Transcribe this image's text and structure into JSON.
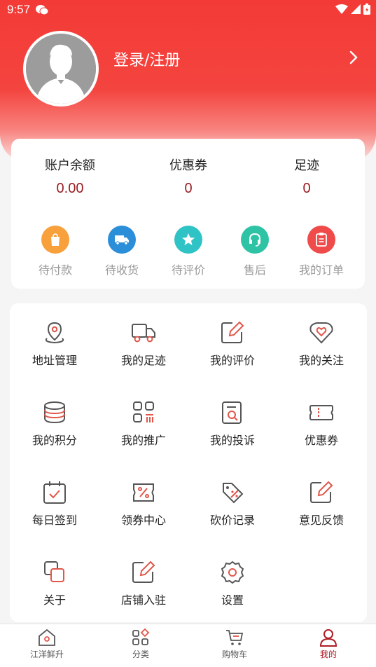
{
  "status": {
    "time": "9:57"
  },
  "header": {
    "login_label": "登录/注册"
  },
  "account": {
    "stats": [
      {
        "label": "账户余额",
        "value": "0.00"
      },
      {
        "label": "优惠券",
        "value": "0"
      },
      {
        "label": "足迹",
        "value": "0"
      }
    ],
    "orders": [
      {
        "label": "待付款",
        "icon": "shopping-bag-icon",
        "color": "#f7a03c"
      },
      {
        "label": "待收货",
        "icon": "truck-icon",
        "color": "#2b8ed8"
      },
      {
        "label": "待评价",
        "icon": "star-icon",
        "color": "#30c3c6"
      },
      {
        "label": "售后",
        "icon": "headset-icon",
        "color": "#2fc3a6"
      },
      {
        "label": "我的订单",
        "icon": "clipboard-icon",
        "color": "#ef4b4b"
      }
    ]
  },
  "menu": {
    "items": [
      {
        "label": "地址管理",
        "icon": "location-pin-icon"
      },
      {
        "label": "我的足迹",
        "icon": "truck-outline-icon"
      },
      {
        "label": "我的评价",
        "icon": "edit-icon"
      },
      {
        "label": "我的关注",
        "icon": "heart-icon"
      },
      {
        "label": "我的积分",
        "icon": "coins-icon"
      },
      {
        "label": "我的推广",
        "icon": "apps-icon"
      },
      {
        "label": "我的投诉",
        "icon": "search-document-icon"
      },
      {
        "label": "优惠券",
        "icon": "coupon-icon"
      },
      {
        "label": "每日签到",
        "icon": "calendar-check-icon"
      },
      {
        "label": "领券中心",
        "icon": "percent-ticket-icon"
      },
      {
        "label": "砍价记录",
        "icon": "price-tag-icon"
      },
      {
        "label": "意见反馈",
        "icon": "feedback-edit-icon"
      },
      {
        "label": "关于",
        "icon": "about-squares-icon"
      },
      {
        "label": "店铺入驻",
        "icon": "store-edit-icon"
      },
      {
        "label": "设置",
        "icon": "gear-icon"
      }
    ]
  },
  "tabbar": {
    "tabs": [
      {
        "label": "江洋鲜升",
        "icon": "home-icon"
      },
      {
        "label": "分类",
        "icon": "category-icon"
      },
      {
        "label": "购物车",
        "icon": "cart-icon"
      },
      {
        "label": "我的",
        "icon": "user-icon",
        "active": true
      }
    ]
  },
  "colors": {
    "brand_red": "#f33a36",
    "value_red": "#9b1c22",
    "icon_gray": "#555555",
    "icon_accent": "#e0574a"
  }
}
